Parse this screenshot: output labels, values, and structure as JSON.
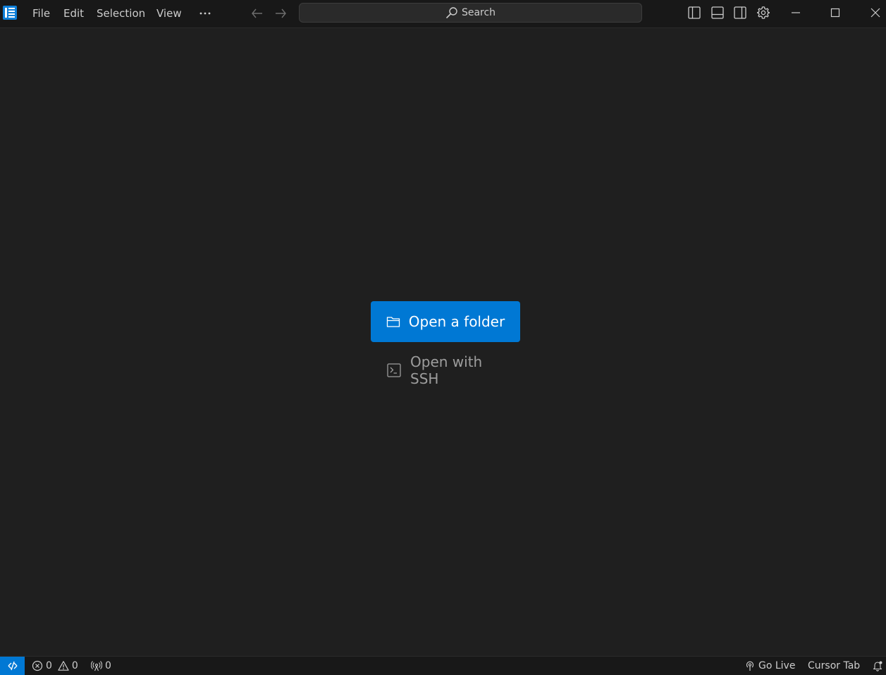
{
  "menu": {
    "file": "File",
    "edit": "Edit",
    "selection": "Selection",
    "view": "View",
    "more_icon": "ellipsis-icon"
  },
  "search": {
    "label": "Search",
    "icon": "search-icon"
  },
  "main": {
    "open_folder_label": "Open a folder",
    "open_ssh_label": "Open with SSH"
  },
  "statusbar": {
    "errors": "0",
    "warnings": "0",
    "ports": "0",
    "go_live": "Go Live",
    "cursor_tab": "Cursor Tab"
  },
  "colors": {
    "accent": "#0078d4",
    "background": "#1f1f1f",
    "titlebar": "#181818",
    "text": "#cccccc",
    "muted_text": "#9d9d9d"
  }
}
